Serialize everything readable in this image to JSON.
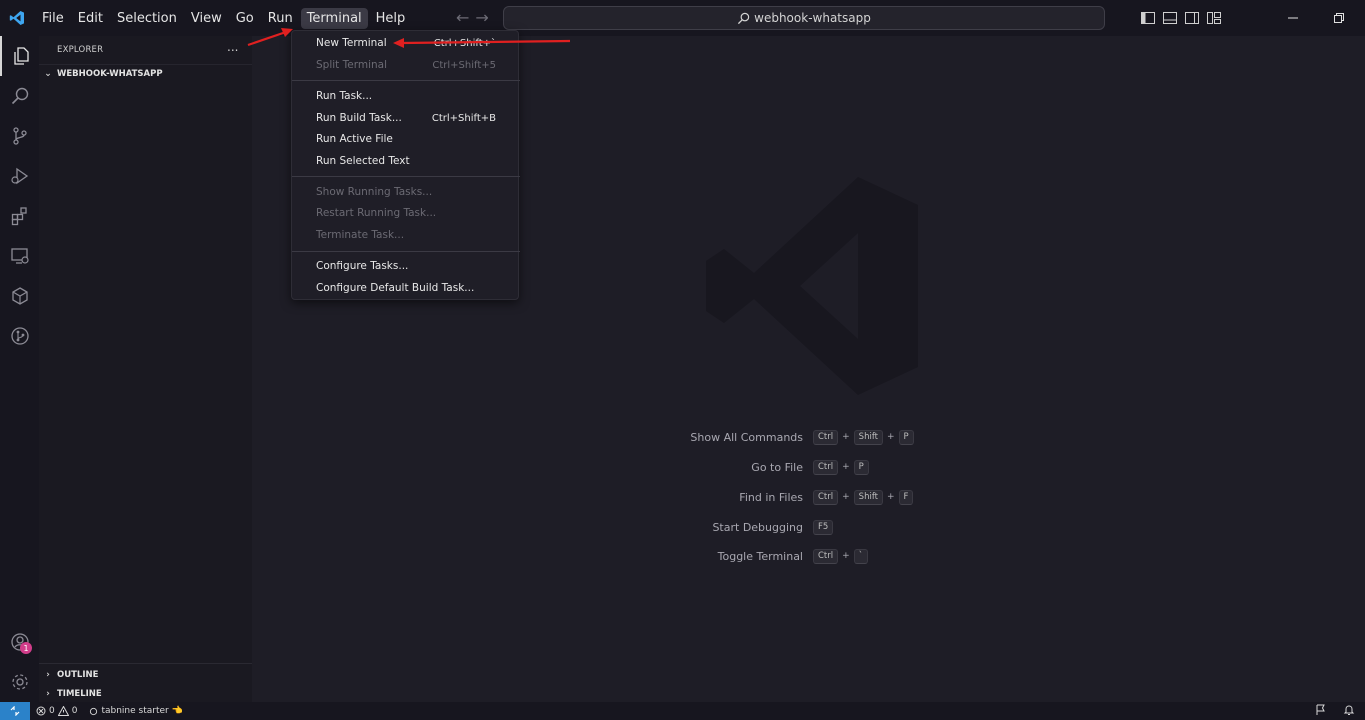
{
  "titlebar": {
    "menu": [
      "File",
      "Edit",
      "Selection",
      "View",
      "Go",
      "Run",
      "Terminal",
      "Help"
    ],
    "active_menu": "Terminal",
    "command_center": "webhook-whatsapp",
    "back_arrow": "←",
    "forward_arrow": "→"
  },
  "activitybar": {
    "icons": [
      "explorer-icon",
      "search-icon",
      "source-control-icon",
      "run-debug-icon",
      "extensions-icon",
      "remote-explorer-icon",
      "kubernetes-icon",
      "git-graph-icon",
      "account-icon",
      "settings-gear-icon"
    ],
    "account_badge": "1"
  },
  "sidebar": {
    "title": "EXPLORER",
    "more": "...",
    "folder": "WEBHOOK-WHATSAPP",
    "outline": "OUTLINE",
    "timeline": "TIMELINE"
  },
  "terminal_menu": {
    "new_terminal": "New Terminal",
    "new_terminal_key": "Ctrl+Shift+`",
    "split_terminal": "Split Terminal",
    "split_terminal_key": "Ctrl+Shift+5",
    "run_task": "Run Task...",
    "run_build_task": "Run Build Task...",
    "run_build_task_key": "Ctrl+Shift+B",
    "run_active_file": "Run Active File",
    "run_selected_text": "Run Selected Text",
    "show_running_tasks": "Show Running Tasks...",
    "restart_running_task": "Restart Running Task...",
    "terminate_task": "Terminate Task...",
    "configure_tasks": "Configure Tasks...",
    "configure_default_build_task": "Configure Default Build Task..."
  },
  "shortcuts": {
    "show_all_commands": "Show All Commands",
    "go_to_file": "Go to File",
    "find_in_files": "Find in Files",
    "start_debugging": "Start Debugging",
    "toggle_terminal": "Toggle Terminal",
    "ctrl": "Ctrl",
    "shift": "Shift",
    "plus": "+",
    "p_key": "P",
    "f_key": "F",
    "f5_key": "F5",
    "backtick_key": "`"
  },
  "statusbar": {
    "errors": "0",
    "warnings": "0",
    "tabnine": "tabnine starter",
    "tabnine_emoji": "👈"
  },
  "colors": {
    "annotation_arrow": "#e02020",
    "remote_button": "#2b82c9",
    "vscode_blue": "#3ea6f0",
    "badge": "#d13d8a"
  }
}
